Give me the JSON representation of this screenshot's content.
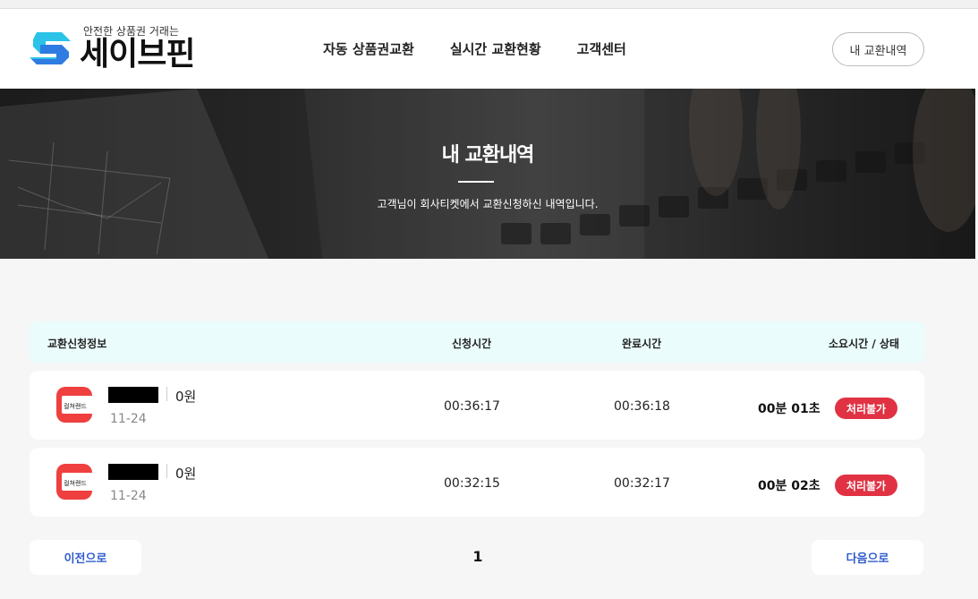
{
  "header": {
    "tagline": "안전한 상품권 거래는",
    "brand": "세이브핀",
    "nav": [
      "자동 상품권교환",
      "실시간 교환현황",
      "고객센터"
    ],
    "my_history_button": "내 교환내역"
  },
  "hero": {
    "title": "내 교환내역",
    "subtitle": "고객님이 회사티켓에서 교환신청하신 내역입니다."
  },
  "table": {
    "headers": {
      "info": "교환신청정보",
      "request_time": "신청시간",
      "complete_time": "완료시간",
      "duration_status": "소요시간 / 상태"
    },
    "rows": [
      {
        "brand_logo_text": "컬쳐랜드",
        "amount": "0원",
        "date": "11-24",
        "request_time": "00:36:17",
        "complete_time": "00:36:18",
        "duration": "00분 01초",
        "status": "처리불가"
      },
      {
        "brand_logo_text": "컬쳐랜드",
        "amount": "0원",
        "date": "11-24",
        "request_time": "00:32:15",
        "complete_time": "00:32:17",
        "duration": "00분 02초",
        "status": "처리불가"
      }
    ]
  },
  "pagination": {
    "prev": "이전으로",
    "page": "1",
    "next": "다음으로"
  },
  "colors": {
    "accent": "#2e5bcc",
    "status_red": "#e03243",
    "brand_red": "#ef3f3f",
    "table_header_bg": "#eafcfc"
  }
}
